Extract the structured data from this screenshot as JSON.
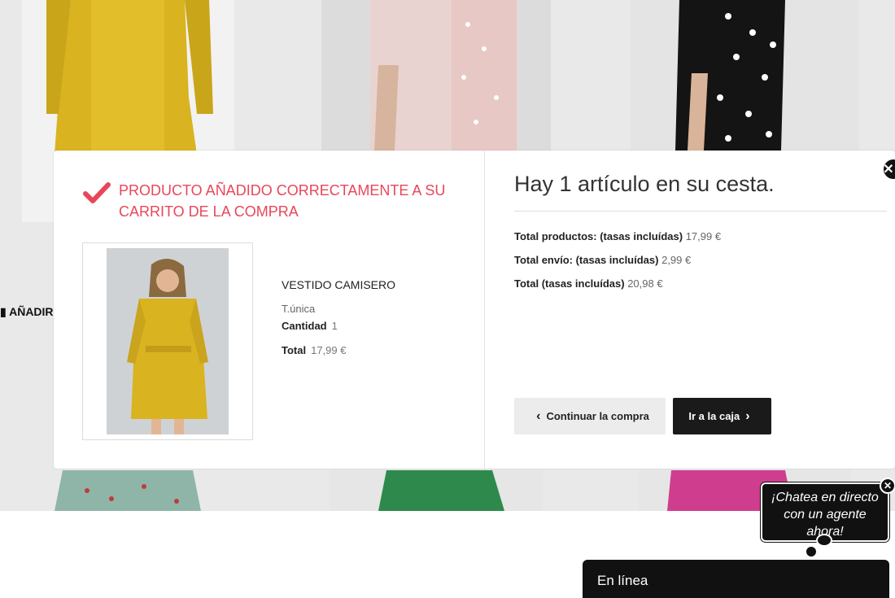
{
  "background": {
    "add_label": "AÑADIR"
  },
  "modal": {
    "success_message": "PRODUCTO AÑADIDO CORRECTAMENTE A SU CARRITO DE LA COMPRA",
    "product": {
      "name": "VESTIDO CAMISERO",
      "variant": "T.única",
      "quantity_label": "Cantidad",
      "quantity": "1",
      "total_label": "Total",
      "total": "17,99 €"
    },
    "cart": {
      "title": "Hay 1 artículo en su cesta.",
      "products_label": "Total productos: (tasas incluídas)",
      "products_value": "17,99 €",
      "shipping_label": "Total envío: (tasas incluídas)",
      "shipping_value": "2,99 €",
      "total_label": "Total (tasas incluídas)",
      "total_value": "20,98 €"
    },
    "buttons": {
      "continue": "Continuar la compra",
      "checkout": "Ir a la caja"
    }
  },
  "chat": {
    "bubble_text": "¡Chatea en directo con un agente ahora!",
    "status": "En línea"
  },
  "colors": {
    "accent": "#e8475a",
    "dark": "#1a1a1a",
    "dress_yellow": "#d9b320"
  }
}
